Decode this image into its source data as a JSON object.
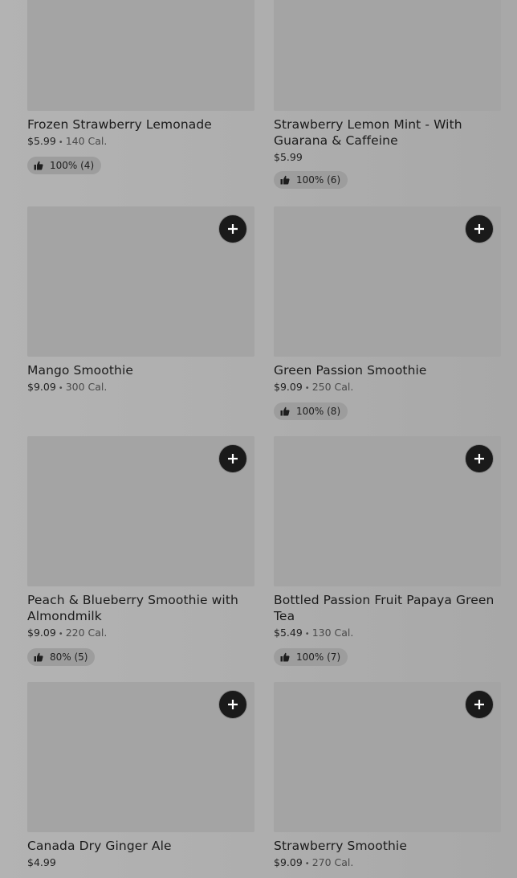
{
  "items": [
    {
      "name": "Frozen Strawberry Lemonade",
      "price": "$5.99",
      "calories": "140 Cal.",
      "rating": "100% (4)"
    },
    {
      "name": "Strawberry Lemon Mint - With Guarana & Caffeine",
      "price": "$5.99",
      "calories": "",
      "rating": "100% (6)"
    },
    {
      "name": "Mango Smoothie",
      "price": "$9.09",
      "calories": "300 Cal.",
      "rating": ""
    },
    {
      "name": "Green Passion Smoothie",
      "price": "$9.09",
      "calories": "250 Cal.",
      "rating": "100% (8)"
    },
    {
      "name": "Peach & Blueberry Smoothie with Almondmilk",
      "price": "$9.09",
      "calories": "220 Cal.",
      "rating": "80% (5)"
    },
    {
      "name": "Bottled Passion Fruit Papaya Green Tea",
      "price": "$5.49",
      "calories": "130 Cal.",
      "rating": "100% (7)"
    },
    {
      "name": "Canada Dry Ginger Ale",
      "price": "$4.99",
      "calories": "",
      "rating": ""
    },
    {
      "name": "Strawberry Smoothie",
      "price": "$9.09",
      "calories": "270 Cal.",
      "rating": ""
    }
  ],
  "separator": "•",
  "icons": {
    "add": "plus-icon",
    "rating": "thumbs-up-icon"
  }
}
